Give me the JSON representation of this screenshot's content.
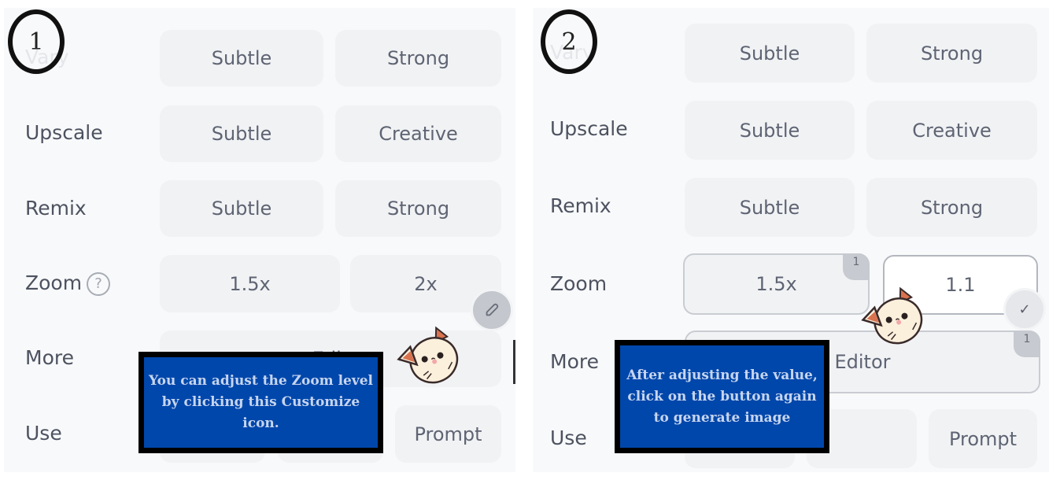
{
  "panels": [
    {
      "step": "1",
      "rows": {
        "vary": {
          "label": "Vary",
          "buttons": [
            "Subtle",
            "Strong"
          ]
        },
        "upscale": {
          "label": "Upscale",
          "buttons": [
            "Subtle",
            "Creative"
          ]
        },
        "remix": {
          "label": "Remix",
          "buttons": [
            "Subtle",
            "Strong"
          ]
        },
        "zoom": {
          "label": "Zoom",
          "help_icon": "?",
          "buttons": [
            "1.5x",
            "2x"
          ]
        },
        "more": {
          "label": "More",
          "buttons": [
            "Edit"
          ]
        },
        "use": {
          "label": "Use",
          "buttons": [
            "",
            "",
            "Prompt"
          ]
        }
      },
      "customize_icon": "pencil-icon",
      "tooltip": "You can adjust the Zoom level by clicking this Customize icon."
    },
    {
      "step": "2",
      "rows": {
        "vary": {
          "label": "Vary",
          "buttons": [
            "Subtle",
            "Strong"
          ]
        },
        "upscale": {
          "label": "Upscale",
          "buttons": [
            "Subtle",
            "Creative"
          ]
        },
        "remix": {
          "label": "Remix",
          "buttons": [
            "Subtle",
            "Strong"
          ]
        },
        "zoom": {
          "label": "Zoom",
          "buttons": [
            "1.5x",
            "1.1"
          ],
          "badge": "1"
        },
        "more": {
          "label": "More",
          "buttons": [
            "Editor"
          ],
          "badge": "1"
        },
        "use": {
          "label": "Use",
          "buttons": [
            "",
            "",
            "Prompt"
          ]
        }
      },
      "confirm_icon": "✓",
      "tooltip": "After adjusting the value, click on the button again to generate image"
    }
  ],
  "colors": {
    "tooltip_bg": "#0047ab",
    "tooltip_text": "#c7d5ef",
    "panel_bg": "#f8f9fa",
    "button_bg": "#f1f2f4"
  }
}
